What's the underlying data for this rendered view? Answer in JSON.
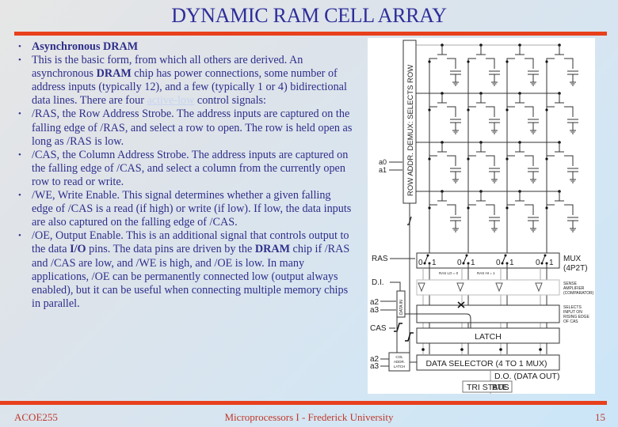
{
  "slide": {
    "title": "DYNAMIC RAM CELL ARRAY",
    "accent_color": "#e8401c",
    "title_color": "#2e2e99",
    "bullets": [
      {
        "bold": "Asynchronous DRAM",
        "text": ""
      },
      {
        "text_parts": [
          "This is the basic form, from which all others are derived. An asynchronous ",
          "DRAM",
          " chip has power connections, some number of address inputs (typically 12), and a few (typically 1 or 4) bidirectional data lines. There are four "
        ],
        "link": "active-low",
        "after_link": " control signals:"
      },
      {
        "text": "/RAS, the Row Address Strobe. The address inputs are captured on the falling edge of /RAS, and select a row to open. The row is held open as long as /RAS is low."
      },
      {
        "text": "/CAS, the Column Address Strobe. The address inputs are captured on the falling edge of /CAS, and select a column from the currently open row to read or write."
      },
      {
        "text": "/WE, Write Enable. This signal determines whether a given falling edge of /CAS is a read (if high) or write (if low). If low, the data inputs are also captured on the falling edge of /CAS."
      },
      {
        "parts": [
          "/OE, Output Enable. This is an additional signal that controls output to the data ",
          "I/O",
          " pins. The data pins are driven by the ",
          "DRAM",
          " chip if /RAS and /CAS are low, and /WE is high, and /OE is low. In many applications, /OE can be permanently connected low (output always enabled), but it can be useful when connecting multiple memory chips in parallel."
        ]
      }
    ]
  },
  "diagram": {
    "row_demux_label": "ROW ADDR. DEMUX: SELECTS ROW",
    "a0": "a0",
    "a1": "a1",
    "a2": "a2",
    "a3": "a3",
    "ras": "RAS",
    "di": "D.I.",
    "cas": "CAS",
    "mux_label_1": "MUX",
    "mux_label_2": "(4P2T)",
    "switch_0": "0",
    "switch_1": "1",
    "ras_lo": "RAS LO = 0",
    "ras_hi": "RAS HI = 1",
    "sense_1": "SENSE",
    "sense_2": "AMPLIFIER",
    "sense_3": "(COMPARATOR)",
    "selects_1": "SELECTS",
    "selects_2": "INPUT ON",
    "selects_3": "RISING EDGE",
    "selects_4": "OF CAS",
    "data_in_latch": "DATA IN",
    "latch": "LATCH",
    "col_latch_1": "COL",
    "col_latch_2": "ADDR.",
    "col_latch_3": "LATCH",
    "data_selector": "DATA SELECTOR (4 TO 1 MUX)",
    "data_out": "D.O. (DATA OUT)",
    "tri_state": "TRI STATE",
    "bus": "BUS"
  },
  "footer": {
    "course": "ACOE255",
    "center": "Microprocessors I - Frederick University",
    "page": "15"
  }
}
